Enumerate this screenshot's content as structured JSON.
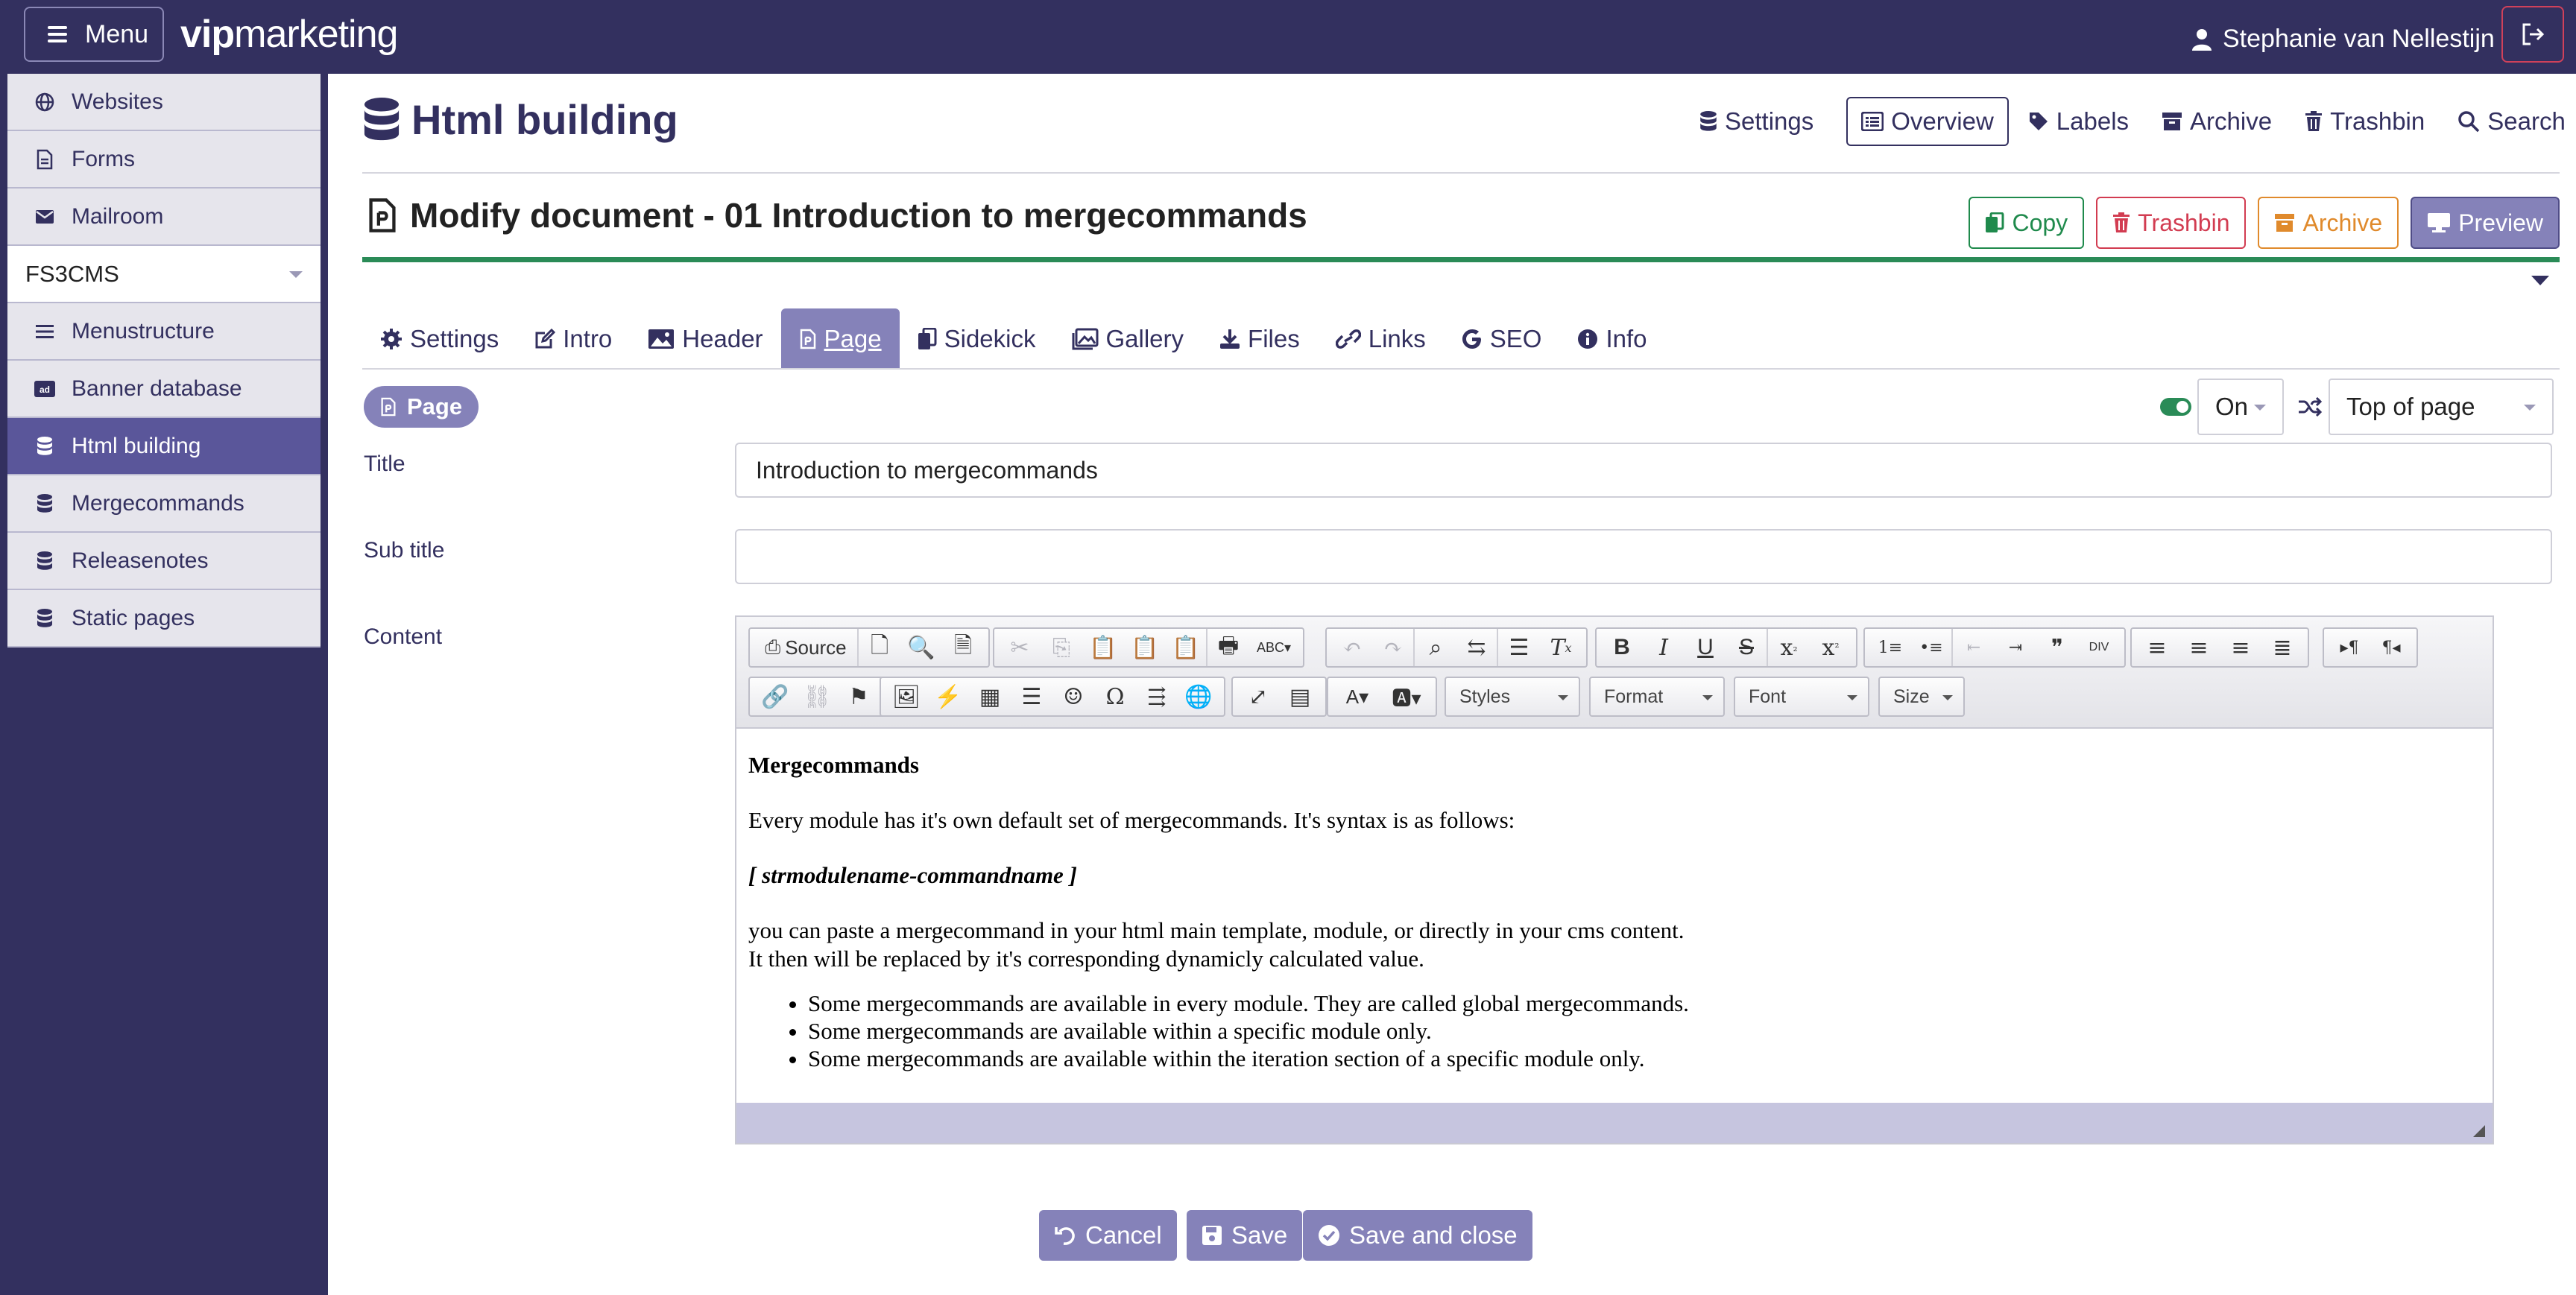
{
  "topbar": {
    "menu_label": "Menu",
    "brand_bold": "vip",
    "brand_rest": "marketing",
    "user_name": "Stephanie van Nellestijn"
  },
  "sidebar": {
    "items_top": [
      {
        "label": "Websites",
        "icon": "globe-icon"
      },
      {
        "label": "Forms",
        "icon": "form-icon"
      },
      {
        "label": "Mailroom",
        "icon": "envelope-icon"
      }
    ],
    "select_value": "FS3CMS",
    "items_sub": [
      {
        "label": "Menustructure",
        "icon": "list-icon"
      },
      {
        "label": "Banner database",
        "icon": "ad-icon"
      },
      {
        "label": "Html building",
        "icon": "database-icon"
      },
      {
        "label": "Mergecommands",
        "icon": "database-icon"
      },
      {
        "label": "Releasenotes",
        "icon": "database-icon"
      },
      {
        "label": "Static pages",
        "icon": "database-icon"
      }
    ],
    "active_item": "Html building"
  },
  "header": {
    "title": "Html building",
    "nav": [
      "Settings",
      "Overview",
      "Labels",
      "Archive",
      "Trashbin",
      "Search"
    ],
    "active_nav": "Overview"
  },
  "document": {
    "title": "Modify document - 01 Introduction to mergecommands",
    "actions": {
      "copy": "Copy",
      "trashbin": "Trashbin",
      "archive": "Archive",
      "preview": "Preview"
    }
  },
  "tabs": [
    "Settings",
    "Intro",
    "Header",
    "Page",
    "Sidekick",
    "Gallery",
    "Files",
    "Links",
    "SEO",
    "Info"
  ],
  "active_tab": "Page",
  "page_section": {
    "pill_label": "Page",
    "toggle_on": true,
    "status_value": "On",
    "position_value": "Top of page"
  },
  "form": {
    "title_label": "Title",
    "title_value": "Introduction to mergecommands",
    "subtitle_label": "Sub title",
    "subtitle_value": "",
    "content_label": "Content"
  },
  "editor": {
    "source_label": "Source",
    "styles_label": "Styles",
    "format_label": "Format",
    "font_label": "Font",
    "size_label": "Size",
    "heading": "Mergecommands",
    "para1": "Every module has it's own default set of mergecommands. It's syntax is as follows:",
    "syntax": "[ strmodulename-commandname ]",
    "para2_line1": "you can paste a mergecommand in your html main template, module, or directly in your cms content.",
    "para2_line2": "It then will be replaced by it's corresponding dynamicly calculated value.",
    "bullets": [
      "Some mergecommands are available in every module. They are called global mergecommands.",
      "Some mergecommands are available within a specific module only.",
      "Some mergecommands are available within the iteration section of a specific module only."
    ]
  },
  "buttons": {
    "cancel": "Cancel",
    "save": "Save",
    "save_close": "Save and close"
  },
  "colors": {
    "brand": "#33305f",
    "accent": "#8582b9",
    "green": "#2a8b57",
    "danger": "#d23c51",
    "warning": "#e08a2c"
  }
}
